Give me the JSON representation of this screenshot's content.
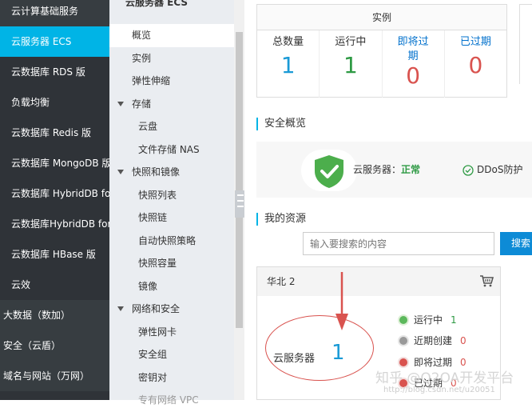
{
  "leftnav": {
    "items": [
      {
        "label": "云计算基础服务"
      },
      {
        "label": "云服务器 ECS"
      },
      {
        "label": "云数据库 RDS 版"
      },
      {
        "label": "负载均衡"
      },
      {
        "label": "云数据库 Redis 版"
      },
      {
        "label": "云数据库 MongoDB 版"
      },
      {
        "label": "云数据库 HybridDB fo..."
      },
      {
        "label": "云数据库HybridDB for..."
      },
      {
        "label": "云数据库 HBase 版"
      },
      {
        "label": "云效"
      },
      {
        "label": "大数据（数加）"
      },
      {
        "label": "安全（云盾）"
      },
      {
        "label": "域名与网站（万网）"
      }
    ]
  },
  "subnav": {
    "header": "云服务器 ECS",
    "items": [
      {
        "label": "概览"
      },
      {
        "label": "实例"
      },
      {
        "label": "弹性伸缩"
      },
      {
        "label": "存储"
      },
      {
        "label": "云盘"
      },
      {
        "label": "文件存储 NAS"
      },
      {
        "label": "快照和镜像"
      },
      {
        "label": "快照列表"
      },
      {
        "label": "快照链"
      },
      {
        "label": "自动快照策略"
      },
      {
        "label": "快照容量"
      },
      {
        "label": "镜像"
      },
      {
        "label": "网络和安全"
      },
      {
        "label": "弹性网卡"
      },
      {
        "label": "安全组"
      },
      {
        "label": "密钥对"
      },
      {
        "label": "专有网络 VPC"
      }
    ]
  },
  "instances": {
    "title": "实例",
    "total_label": "总数量",
    "total_value": "1",
    "running_label": "运行中",
    "running_value": "1",
    "expiring_label": "即将过期",
    "expiring_value": "0",
    "expired_label": "已过期",
    "expired_value": "0"
  },
  "security": {
    "title": "安全概览",
    "server_label": "云服务器：",
    "server_status": "正常",
    "ddos_label": "DDoS防护"
  },
  "resources": {
    "title": "我的资源",
    "search_placeholder": "输入要搜索的内容",
    "search_button": "搜索",
    "region": "华北 2",
    "ecs_label": "云服务器",
    "ecs_count": "1",
    "stats": [
      {
        "label": "运行中",
        "value": "1"
      },
      {
        "label": "近期创建",
        "value": "0"
      },
      {
        "label": "即将过期",
        "value": "0"
      },
      {
        "label": "已过期",
        "value": "0"
      }
    ]
  },
  "watermark": {
    "main": "知乎 @Q2OA开发平台",
    "sub": "http://blog.csdn.net/u20051"
  },
  "colors": {
    "accent": "#00b4e6",
    "running": "#2e9a44",
    "danger": "#d9534f",
    "link": "#0070cc"
  }
}
